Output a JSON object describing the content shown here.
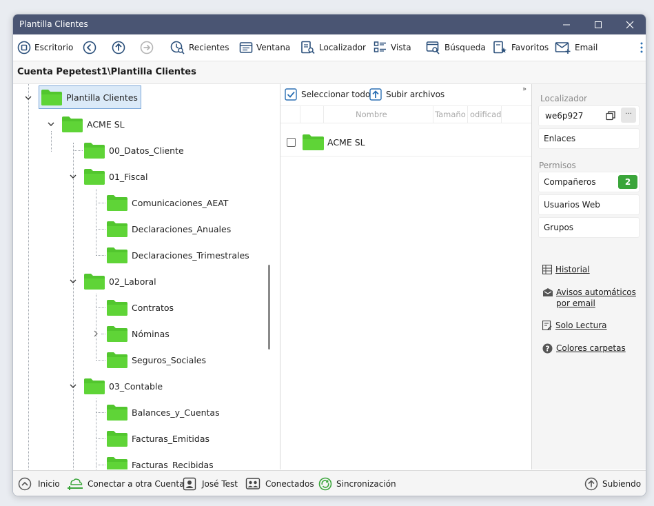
{
  "window": {
    "title": "Plantilla Clientes"
  },
  "toolbar": {
    "items": [
      {
        "label": "Escritorio",
        "icon": "desktop-icon"
      },
      {
        "label": "",
        "icon": "back-icon"
      },
      {
        "label": "",
        "icon": "up-icon"
      },
      {
        "label": "",
        "icon": "forward-icon"
      },
      {
        "label": "Recientes",
        "icon": "recent-icon"
      },
      {
        "label": "Ventana",
        "icon": "window-icon"
      },
      {
        "label": "Localizador",
        "icon": "locator-icon"
      },
      {
        "label": "Vista",
        "icon": "view-icon"
      },
      {
        "label": "Búsqueda",
        "icon": "search-icon"
      },
      {
        "label": "Favoritos",
        "icon": "favorites-icon"
      },
      {
        "label": "Email",
        "icon": "email-icon"
      }
    ]
  },
  "path": "Cuenta Pepetest1\\Plantilla Clientes",
  "tree": {
    "nodes": [
      {
        "label": "Plantilla Clientes",
        "level": 0,
        "expanded": true,
        "selected": true
      },
      {
        "label": "ACME SL",
        "level": 1,
        "expanded": true
      },
      {
        "label": "00_Datos_Cliente",
        "level": 2
      },
      {
        "label": "01_Fiscal",
        "level": 2,
        "expanded": true
      },
      {
        "label": "Comunicaciones_AEAT",
        "level": 3
      },
      {
        "label": "Declaraciones_Anuales",
        "level": 3
      },
      {
        "label": "Declaraciones_Trimestrales",
        "level": 3
      },
      {
        "label": "02_Laboral",
        "level": 2,
        "expanded": true
      },
      {
        "label": "Contratos",
        "level": 3
      },
      {
        "label": "Nóminas",
        "level": 3,
        "collapsed_child": true
      },
      {
        "label": "Seguros_Sociales",
        "level": 3
      },
      {
        "label": "03_Contable",
        "level": 2,
        "expanded": true
      },
      {
        "label": "Balances_y_Cuentas",
        "level": 3
      },
      {
        "label": "Facturas_Emitidas",
        "level": 3
      },
      {
        "label": "Facturas_Recibidas",
        "level": 3
      }
    ]
  },
  "files": {
    "select_all": "Seleccionar todo",
    "upload": "Subir archivos",
    "columns": {
      "name": "Nombre",
      "size": "Tamaño",
      "modified": "odificad"
    },
    "rows": [
      {
        "name": "ACME SL"
      }
    ]
  },
  "sidebar": {
    "locator_title": "Localizador",
    "locator_value": "we6p927",
    "more": "···",
    "links_label": "Enlaces",
    "permissions_title": "Permisos",
    "companions_label": "Compañeros",
    "companions_count": "2",
    "web_users_label": "Usuarios Web",
    "groups_label": "Grupos",
    "history": "Historial",
    "auto_notices_1": "Avisos automáticos",
    "auto_notices_2": "por email",
    "read_only": "Solo Lectura",
    "folder_colors": "Colores carpetas"
  },
  "status": {
    "home": "Inicio",
    "connect_other": "Conectar a otra Cuenta",
    "user": "José Test",
    "connected": "Conectados",
    "sync": "Sincronización",
    "uploading": "Subiendo"
  },
  "colors": {
    "titlebar": "#4a5573",
    "folder_green": "#52c62e",
    "accent_blue": "#2a6fb3",
    "badge_green": "#3aa53a"
  }
}
